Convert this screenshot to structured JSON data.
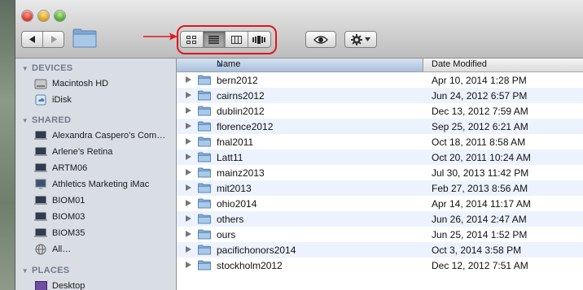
{
  "toolbar": {
    "nav": {
      "back_icon": "chevron-left-icon",
      "forward_icon": "chevron-right-icon"
    },
    "view_modes": [
      {
        "name": "icon-view",
        "icon": "grid-icon",
        "active": false
      },
      {
        "name": "list-view",
        "icon": "list-icon",
        "active": true
      },
      {
        "name": "column-view",
        "icon": "columns-icon",
        "active": false
      },
      {
        "name": "cover-flow-view",
        "icon": "cover-flow-icon",
        "active": false
      }
    ],
    "quick_look_icon": "eye-icon",
    "action_icon": "gear-icon",
    "annotation_color": "#e0161b"
  },
  "sidebar": {
    "devices_header": "DEVICES",
    "devices": [
      {
        "label": "Macintosh HD",
        "icon": "hard-drive-icon"
      },
      {
        "label": "iDisk",
        "icon": "idisk-icon"
      }
    ],
    "shared_header": "SHARED",
    "shared": [
      {
        "label": "Alexandra Caspero’s Com…",
        "icon": "computer-icon"
      },
      {
        "label": "Arlene’s Retina",
        "icon": "computer-icon"
      },
      {
        "label": "ARTM06",
        "icon": "computer-icon"
      },
      {
        "label": "Athletics Marketing iMac",
        "icon": "imac-icon"
      },
      {
        "label": "BIOM01",
        "icon": "computer-icon"
      },
      {
        "label": "BIOM03",
        "icon": "computer-icon"
      },
      {
        "label": "BIOM35",
        "icon": "computer-icon"
      },
      {
        "label": "All…",
        "icon": "network-globe-icon"
      }
    ],
    "places_header": "PLACES",
    "places": [
      {
        "label": "Desktop",
        "icon": "desktop-icon"
      }
    ]
  },
  "list": {
    "columns": {
      "name": "Name",
      "date": "Date Modified"
    },
    "rows": [
      {
        "name": "bern2012",
        "date": "Apr 10, 2014 1:28 PM"
      },
      {
        "name": "cairns2012",
        "date": "Jun 24, 2012 6:57 PM"
      },
      {
        "name": "dublin2012",
        "date": "Dec 13, 2012 7:59 AM"
      },
      {
        "name": "florence2012",
        "date": "Sep 25, 2012 6:21 AM"
      },
      {
        "name": "fnal2011",
        "date": "Oct 18, 2011 8:58 AM"
      },
      {
        "name": "Latt11",
        "date": "Oct 20, 2011 10:24 AM"
      },
      {
        "name": "mainz2013",
        "date": "Jul 30, 2013 11:42 PM"
      },
      {
        "name": "mit2013",
        "date": "Feb 27, 2013 8:56 AM"
      },
      {
        "name": "ohio2014",
        "date": "Apr 14, 2014 11:17 AM"
      },
      {
        "name": "others",
        "date": "Jun 26, 2014 2:47 AM"
      },
      {
        "name": "ours",
        "date": "Jun 25, 2014 1:52 PM"
      },
      {
        "name": "pacifichonors2014",
        "date": "Oct 3, 2014 3:58 PM"
      },
      {
        "name": "stockholm2012",
        "date": "Dec 12, 2012 7:51 AM"
      }
    ]
  }
}
